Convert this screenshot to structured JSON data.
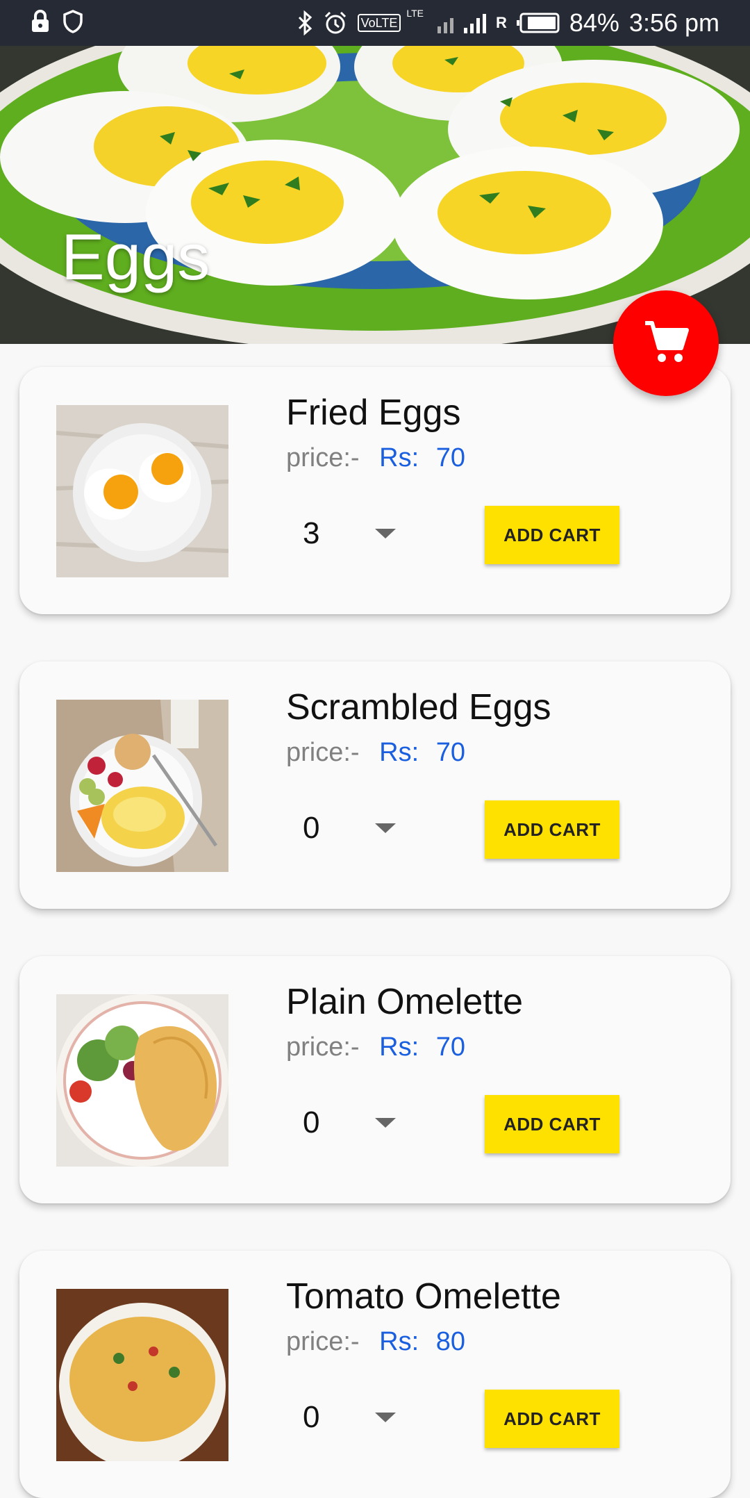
{
  "status_bar": {
    "battery": "84%",
    "time": "3:56 pm",
    "volte": "VoLTE",
    "lte": "LTE",
    "roaming": "R",
    "icons": [
      "lock-icon",
      "shield-icon",
      "bluetooth-icon",
      "alarm-icon",
      "signal-icon",
      "battery-icon"
    ]
  },
  "header": {
    "title": "Eggs"
  },
  "fab": {
    "icon": "cart-icon",
    "color": "#ff0000"
  },
  "items": [
    {
      "name": "Fried Eggs",
      "price_label": "price:-",
      "currency": "Rs:",
      "price": "70",
      "qty": "3",
      "button": "ADD CART"
    },
    {
      "name": "Scrambled Eggs",
      "price_label": "price:-",
      "currency": "Rs:",
      "price": "70",
      "qty": "0",
      "button": "ADD CART"
    },
    {
      "name": "Plain Omelette",
      "price_label": "price:-",
      "currency": "Rs:",
      "price": "70",
      "qty": "0",
      "button": "ADD CART"
    },
    {
      "name": "Tomato Omelette",
      "price_label": "price:-",
      "currency": "Rs:",
      "price": "80",
      "qty": "0",
      "button": "ADD CART"
    }
  ],
  "colors": {
    "status_bar_bg": "#262a34",
    "price": "#1a5fe0",
    "button_bg": "#ffe100",
    "fab_bg": "#ff0000"
  }
}
